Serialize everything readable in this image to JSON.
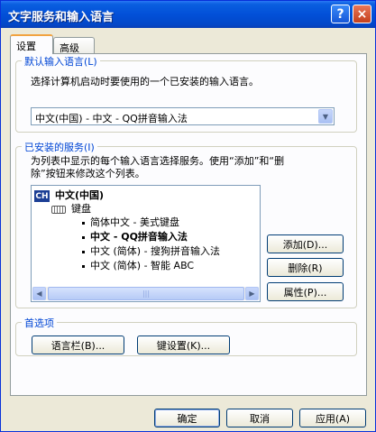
{
  "window": {
    "title": "文字服务和输入语言",
    "help_label": "?",
    "close_label": "×"
  },
  "tabs": [
    {
      "label": "设置",
      "active": true
    },
    {
      "label": "高级",
      "active": false
    }
  ],
  "default_input": {
    "label": "默认输入语言(L)",
    "description": "选择计算机启动时要使用的一个已安装的输入语言。",
    "selected": "中文(中国) - 中文 - QQ拼音输入法"
  },
  "installed": {
    "label": "已安装的服务(I)",
    "description_line1": "为列表中显示的每个输入语言选择服务。使用“添加”和“删",
    "description_line2": "除”按钮来修改这个列表。",
    "language_badge": "CH",
    "language_name": "中文(中国)",
    "keyboard_label": "键盘",
    "services": [
      "简体中文 - 美式键盘",
      "中文 - QQ拼音输入法",
      "中文 (简体) - 搜狗拼音输入法",
      "中文 (简体) - 智能 ABC"
    ],
    "selected_index": 1
  },
  "side_buttons": {
    "add": "添加(D)...",
    "remove": "删除(R)",
    "properties": "属性(P)..."
  },
  "preferences": {
    "label": "首选项",
    "language_bar": "语言栏(B)...",
    "key_settings": "键设置(K)..."
  },
  "footer": {
    "ok": "确定",
    "cancel": "取消",
    "apply": "应用(A)"
  }
}
